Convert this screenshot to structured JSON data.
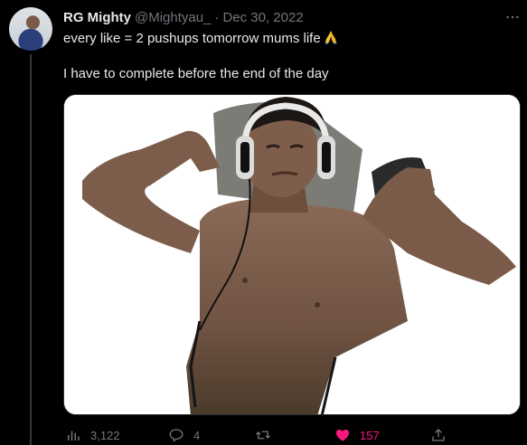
{
  "author": {
    "name": "RG Mighty",
    "handle": "@Mightyau_",
    "separator": "·",
    "date": "Dec 30, 2022"
  },
  "tweet": {
    "line1": "every like = 2 pushups tomorrow mums life",
    "emoji": "folded-hands-emoji",
    "line2": "I have to complete before the end of the day"
  },
  "more_label": "···",
  "actions": {
    "views": "3,122",
    "replies": "4",
    "retweets": "",
    "likes": "157",
    "share": ""
  },
  "colors": {
    "background": "#000000",
    "text": "#e7e9ea",
    "secondary": "#71767b",
    "like": "#f91880"
  }
}
